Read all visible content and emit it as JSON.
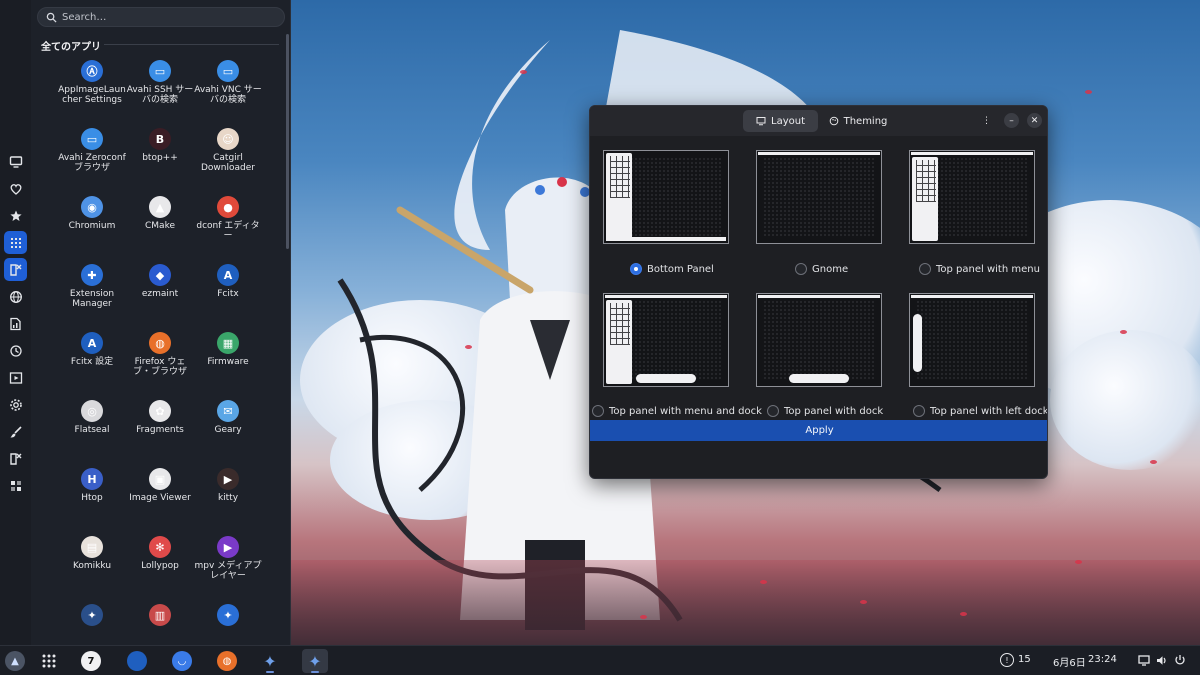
{
  "launcher": {
    "search_placeholder": "Search…",
    "section_title": "全てのアプリ",
    "rail": [
      {
        "icon": "monitor-icon",
        "active": false
      },
      {
        "icon": "heart-icon",
        "active": false
      },
      {
        "icon": "star-icon",
        "active": false
      },
      {
        "icon": "apps-grid-icon",
        "active": true
      },
      {
        "icon": "development-icon",
        "active": true
      },
      {
        "icon": "globe-icon",
        "active": false
      },
      {
        "icon": "office-chart-icon",
        "active": false
      },
      {
        "icon": "history-icon",
        "active": false
      },
      {
        "icon": "multimedia-icon",
        "active": false
      },
      {
        "icon": "gear-icon",
        "active": false
      },
      {
        "icon": "brush-icon",
        "active": false
      },
      {
        "icon": "system-icon",
        "active": false
      },
      {
        "icon": "utilities-icon",
        "active": false
      }
    ],
    "apps": [
      {
        "name": "AppImageLauncher Settings",
        "glyph": "Ⓐ",
        "color": "#2a6fd6"
      },
      {
        "name": "Avahi SSH サーバの検索",
        "glyph": "▭",
        "color": "#3a8ee6"
      },
      {
        "name": "Avahi VNC サーバの検索",
        "glyph": "▭",
        "color": "#3a8ee6"
      },
      {
        "name": "Avahi Zeroconf ブラウザ",
        "glyph": "▭",
        "color": "#3a8ee6"
      },
      {
        "name": "btop++",
        "glyph": "B",
        "color": "#3a1d25"
      },
      {
        "name": "Catgirl Downloader",
        "glyph": "☺",
        "color": "#e8d7c8"
      },
      {
        "name": "Chromium",
        "glyph": "◉",
        "color": "#4f93e6"
      },
      {
        "name": "CMake",
        "glyph": "▲",
        "color": "#e8e8ea"
      },
      {
        "name": "dconf エディター",
        "glyph": "●",
        "color": "#e04a3a"
      },
      {
        "name": "Extension Manager",
        "glyph": "✚",
        "color": "#2a6fd6"
      },
      {
        "name": "ezmaint",
        "glyph": "◆",
        "color": "#2a5bd0"
      },
      {
        "name": "Fcitx",
        "glyph": "A",
        "color": "#1f5fbf"
      },
      {
        "name": "Fcitx 設定",
        "glyph": "A",
        "color": "#1f5fbf"
      },
      {
        "name": "Firefox ウェブ・ブラウザ",
        "glyph": "◍",
        "color": "#e8702a"
      },
      {
        "name": "Firmware",
        "glyph": "▦",
        "color": "#3aa66a"
      },
      {
        "name": "Flatseal",
        "glyph": "◎",
        "color": "#d9d9dc"
      },
      {
        "name": "Fragments",
        "glyph": "✿",
        "color": "#e8e8ea"
      },
      {
        "name": "Geary",
        "glyph": "✉",
        "color": "#5aa6e6"
      },
      {
        "name": "Htop",
        "glyph": "H",
        "color": "#3a5fc8"
      },
      {
        "name": "Image Viewer",
        "glyph": "▣",
        "color": "#e8e8ea"
      },
      {
        "name": "kitty",
        "glyph": "▶",
        "color": "#3a2b2b"
      },
      {
        "name": "Komikku",
        "glyph": "▤",
        "color": "#e8e2dc"
      },
      {
        "name": "Lollypop",
        "glyph": "✻",
        "color": "#e04a4a"
      },
      {
        "name": "mpv メディアプレイヤー",
        "glyph": "▶",
        "color": "#7a3ac8"
      },
      {
        "name": "",
        "glyph": "✦",
        "color": "#2a4f8a"
      },
      {
        "name": "",
        "glyph": "▥",
        "color": "#c84a4a"
      },
      {
        "name": "",
        "glyph": "✦",
        "color": "#2a6fd6"
      }
    ]
  },
  "dialog": {
    "tabs": [
      {
        "label": "Layout",
        "icon": "monitor-icon",
        "active": true
      },
      {
        "label": "Theming",
        "icon": "palette-icon",
        "active": false
      }
    ],
    "layouts": [
      {
        "label": "Bottom Panel",
        "selected": true
      },
      {
        "label": "Gnome",
        "selected": false
      },
      {
        "label": "Top panel with menu",
        "selected": false
      },
      {
        "label": "Top panel with menu and dock",
        "selected": false
      },
      {
        "label": "Top panel with dock",
        "selected": false
      },
      {
        "label": "Top panel with left dock",
        "selected": false
      }
    ],
    "apply_label": "Apply"
  },
  "taskbar": {
    "launcher_icon": "arch-icon",
    "apps": [
      {
        "icon": "apps-grid-icon",
        "running": false
      },
      {
        "icon": "calendar-icon",
        "badge": "7",
        "running": false
      },
      {
        "icon": "files-icon",
        "running": false
      },
      {
        "icon": "browser-icon",
        "running": false
      },
      {
        "icon": "firefox-icon",
        "running": false
      },
      {
        "icon": "layout-app-icon",
        "running": true
      },
      {
        "icon": "layout-app-icon",
        "running": true
      }
    ],
    "updates_count": "15",
    "date": "6月6日",
    "time": "23:24",
    "tray": [
      "screen-icon",
      "volume-icon",
      "power-icon"
    ]
  },
  "colors": {
    "accent": "#2d6ee0",
    "panel": "#1b1e25",
    "drawer": "#1d2129"
  }
}
